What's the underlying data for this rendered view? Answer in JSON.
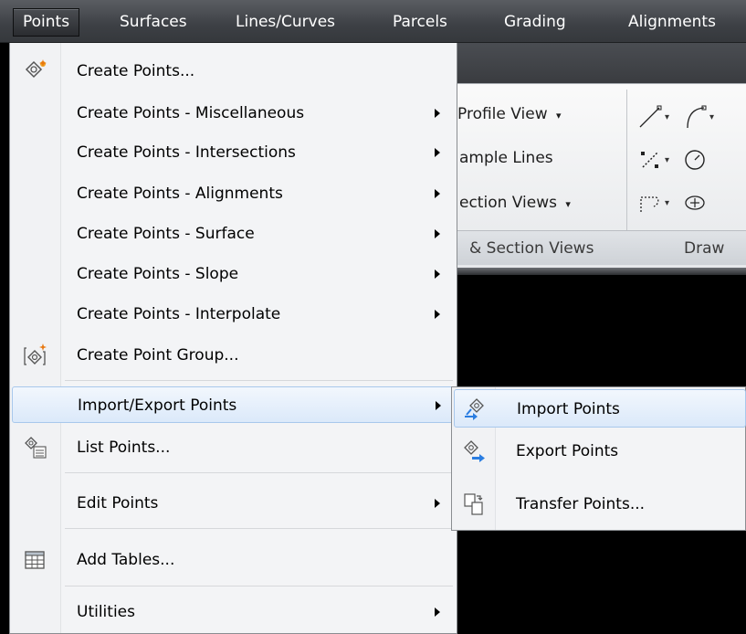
{
  "menubar": {
    "items": [
      "Points",
      "Surfaces",
      "Lines/Curves",
      "Parcels",
      "Grading",
      "Alignments"
    ]
  },
  "ribbon": {
    "profile_view": "Profile View",
    "sample_lines": "ample Lines",
    "section_views": "ection Views",
    "panel_title_left": "& Section Views",
    "panel_title_right": "Draw",
    "dropdown_caret": "▾"
  },
  "points_menu": {
    "items": [
      {
        "label": "Create Points...",
        "icon": "create-points-icon"
      },
      {
        "label": "Create Points - Miscellaneous",
        "submenu": true
      },
      {
        "label": "Create Points - Intersections",
        "submenu": true
      },
      {
        "label": "Create Points - Alignments",
        "submenu": true
      },
      {
        "label": "Create Points - Surface",
        "submenu": true
      },
      {
        "label": "Create Points - Slope",
        "submenu": true
      },
      {
        "label": "Create Points - Interpolate",
        "submenu": true
      },
      {
        "label": "Create Point Group...",
        "icon": "create-point-group-icon"
      },
      {
        "label": "Import/Export Points",
        "submenu": true,
        "highlighted": true
      },
      {
        "label": "List Points...",
        "icon": "list-points-icon"
      },
      {
        "label": "Edit Points",
        "submenu": true
      },
      {
        "label": "Add Tables...",
        "icon": "add-tables-icon"
      },
      {
        "label": "Utilities",
        "submenu": true
      }
    ]
  },
  "import_export_submenu": {
    "items": [
      {
        "label": "Import Points",
        "icon": "import-points-icon",
        "highlighted": true
      },
      {
        "label": "Export Points",
        "icon": "export-points-icon"
      },
      {
        "label": "Transfer Points...",
        "icon": "transfer-points-icon"
      }
    ]
  },
  "colors": {
    "highlight_border": "#a8c8ec",
    "menubar_bg": "#3d4045",
    "accent_blue": "#2a7de1"
  }
}
